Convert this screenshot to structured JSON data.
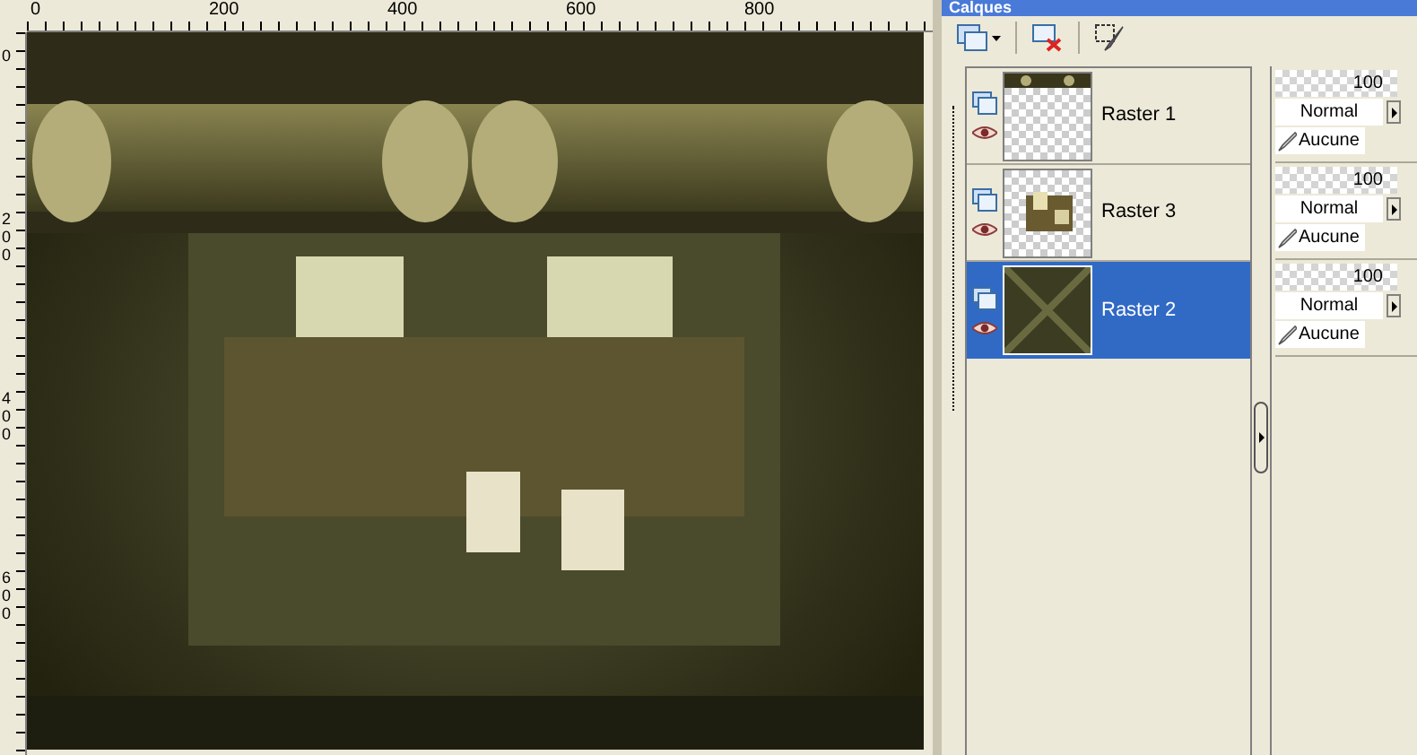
{
  "window": {
    "title": "Calques"
  },
  "rulers": {
    "horizontal": [
      "0",
      "200",
      "400",
      "600",
      "800"
    ],
    "vertical": [
      "0",
      "200",
      "400",
      "600"
    ]
  },
  "layers": [
    {
      "name": "Raster 1",
      "kind": "bars",
      "selected": false,
      "opacity": "100",
      "blend_mode": "Normal",
      "mask": "Aucune"
    },
    {
      "name": "Raster 3",
      "kind": "room",
      "selected": false,
      "opacity": "100",
      "blend_mode": "Normal",
      "mask": "Aucune"
    },
    {
      "name": "Raster 2",
      "kind": "gradient",
      "selected": true,
      "opacity": "100",
      "blend_mode": "Normal",
      "mask": "Aucune"
    }
  ]
}
